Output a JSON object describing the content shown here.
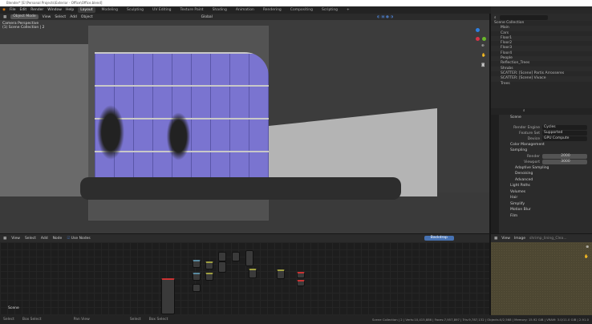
{
  "window": {
    "title": "Blender* [E:\\Personal Projects\\Exterior - Office\\Office.blend]"
  },
  "menu": [
    "File",
    "Edit",
    "Render",
    "Window",
    "Help"
  ],
  "workspaces": [
    "Layout",
    "Modeling",
    "Sculpting",
    "UV Editing",
    "Texture Paint",
    "Shading",
    "Animation",
    "Rendering",
    "Compositing",
    "Scripting",
    "+"
  ],
  "active_workspace": "Layout",
  "viewport": {
    "mode": "Object Mode",
    "menus": [
      "View",
      "Select",
      "Add",
      "Object"
    ],
    "transform_orientation": "Global",
    "overlay_line1": "Camera Perspective",
    "overlay_line2": "(1) Scene Collection | 2"
  },
  "topright": {
    "scene": "Scene",
    "view_layer": "View Layer"
  },
  "outliner": {
    "root": "Scene Collection",
    "items": [
      "Main",
      "Cars",
      "Floor1",
      "Floor2",
      "Floor3",
      "Floor4",
      "People",
      "Reflection_Trees",
      "Shrubs",
      "SCATTER: [Scene] Partis Arrosseres",
      "SCATTER: [Scene] Vivace",
      "Trees"
    ]
  },
  "properties": {
    "title": "Scene",
    "render_engine_label": "Render Engine",
    "render_engine": "Cycles",
    "feature_set_label": "Feature Set",
    "feature_set": "Supported",
    "device_label": "Device",
    "device": "GPU Compute",
    "sections": [
      "Color Management",
      "Sampling"
    ],
    "render_label": "Render",
    "render_samples": "2000",
    "viewport_label": "Viewport",
    "viewport_samples": "3000",
    "sub": [
      "Adaptive Sampling",
      "Denoising",
      "Advanced"
    ],
    "sections2": [
      "Light Paths",
      "Volumes",
      "Hair",
      "Simplify",
      "Motion Blur",
      "Film"
    ]
  },
  "node_editor": {
    "menus": [
      "View",
      "Select",
      "Add",
      "Node"
    ],
    "use_nodes": "Use Nodes",
    "backdrop": "Backdrop",
    "label": "Scene"
  },
  "image_editor": {
    "menus": [
      "View",
      "Image"
    ],
    "image": "shrimp_lining_Clea..."
  },
  "status": {
    "left": [
      "Select",
      "Box Select",
      "Pan View",
      "Select",
      "Box Select"
    ],
    "right": "Scene Collection | 2 | Verts:10,415,886 | Faces:7,957,897 | Tris:9,787,132 | Objects:0/2,568 | Memory: 15.92 GiB | VRAM: 3.0/11.0 GiB | 2.91.0"
  },
  "colors": {
    "accent": "#4772b3",
    "glass": "#7a74d0"
  }
}
